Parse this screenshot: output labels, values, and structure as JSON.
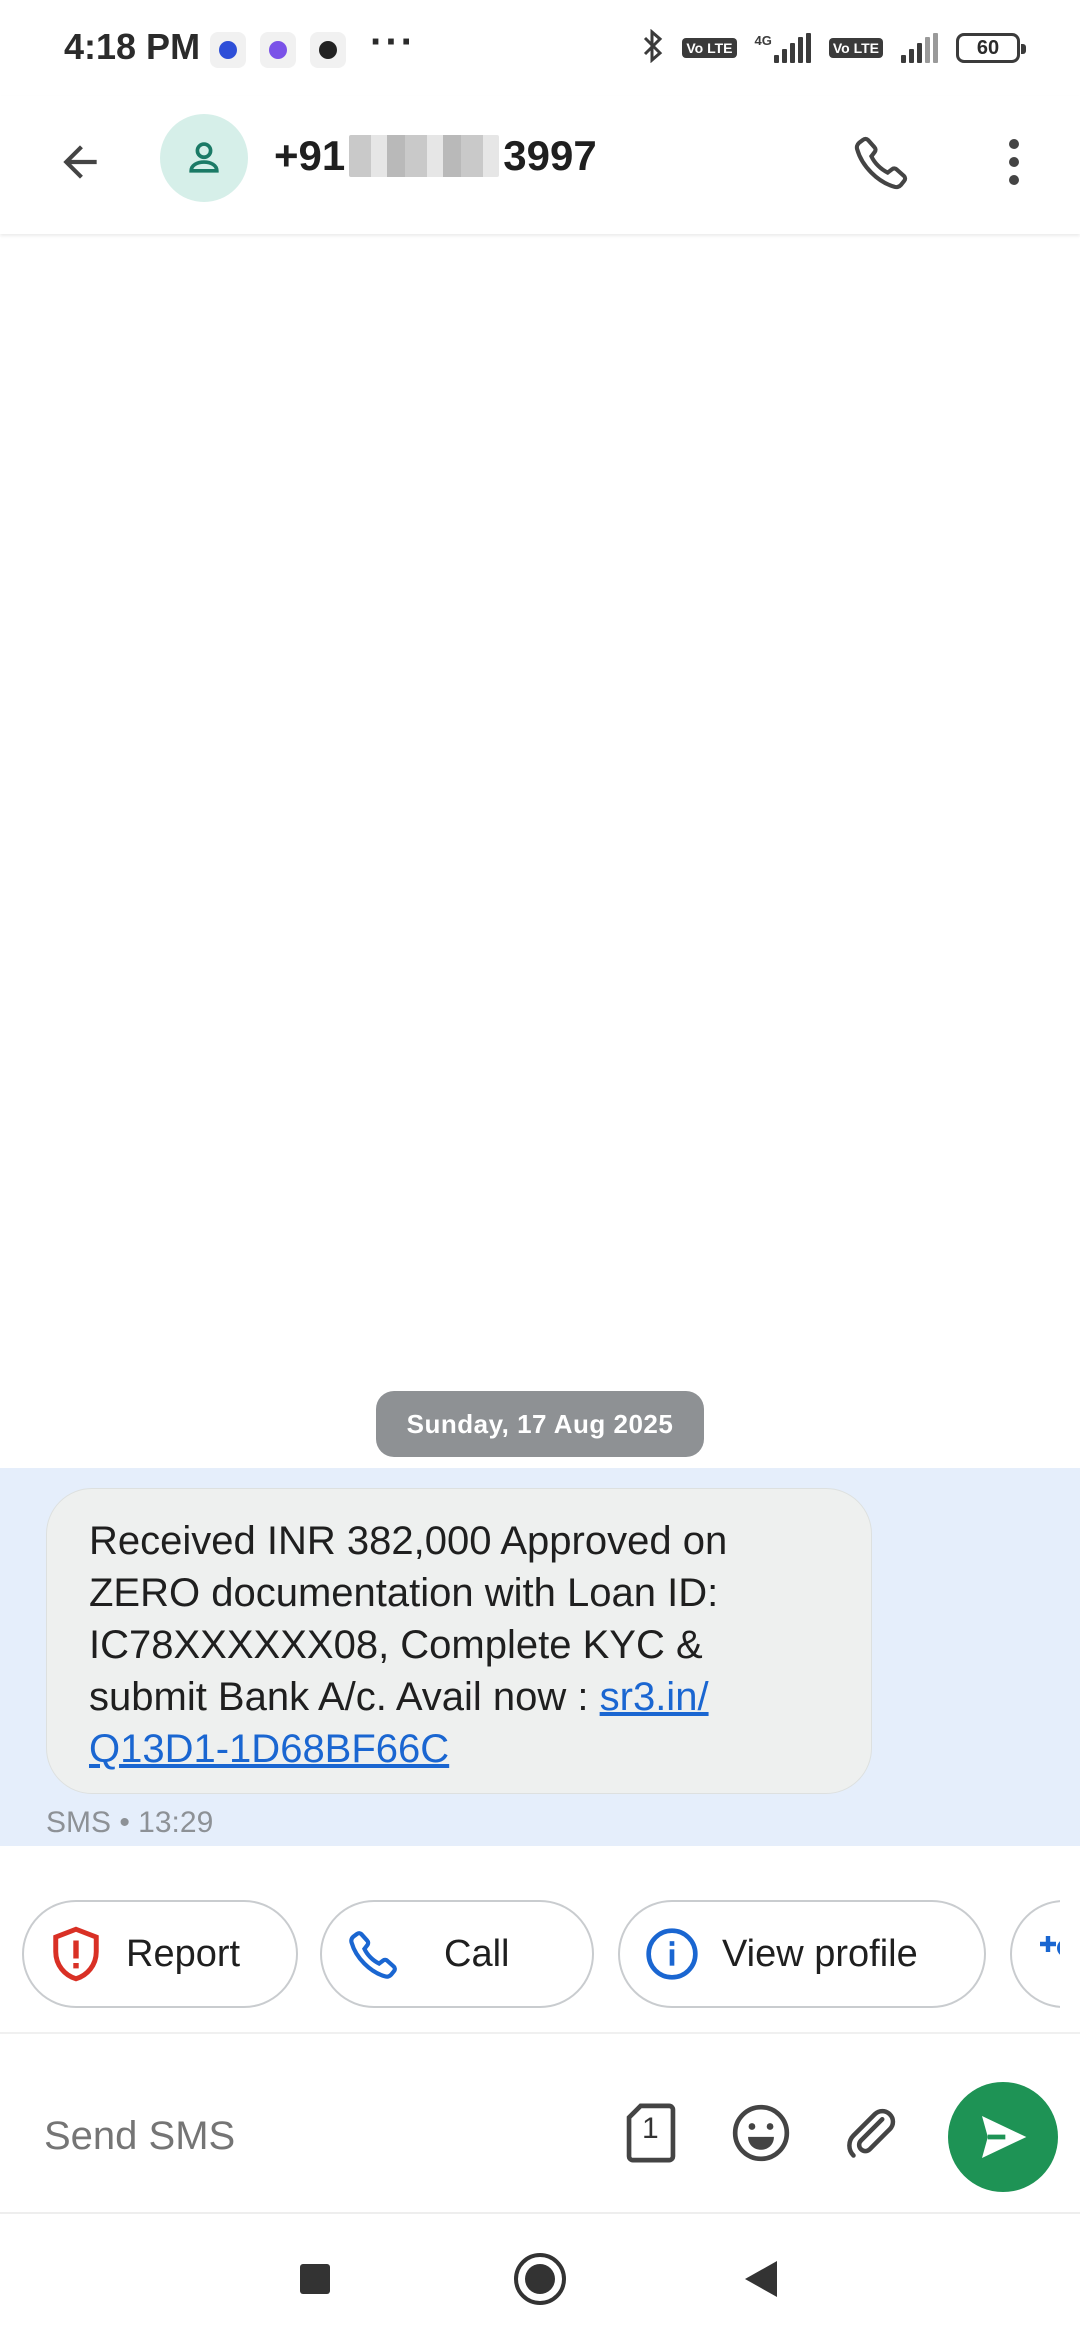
{
  "status_bar": {
    "time": "4:18 PM",
    "more": "···",
    "network_type": "4G",
    "volte_label": "Vo LTE",
    "battery": "60"
  },
  "app_bar": {
    "contact_prefix": "+91",
    "contact_suffix": "3997"
  },
  "conversation": {
    "date_chip": "Sunday, 17 Aug 2025",
    "message": {
      "text": "Received INR 382,000 Approved on ZERO documentation with Loan ID: IC78XXXXXX08, Complete KYC & submit Bank A/c. Avail now : ",
      "link": "sr3.in/ Q13D1-1D68BF66C",
      "meta": "SMS • 13:29"
    }
  },
  "suggestions": {
    "report": "Report",
    "call": "Call",
    "view_profile": "View profile"
  },
  "compose": {
    "placeholder": "Send SMS",
    "sim_label": "1"
  },
  "colors": {
    "accent_green": "#1e9355",
    "link_blue": "#1a66d1",
    "report_red": "#d93025",
    "highlight_bg": "#e5eefb"
  }
}
